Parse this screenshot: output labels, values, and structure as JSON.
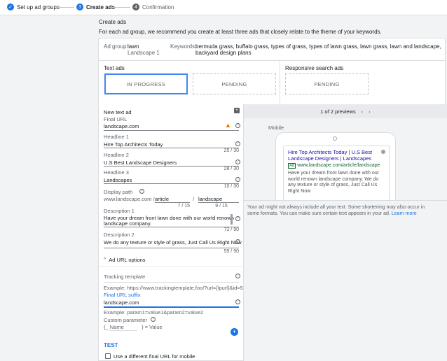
{
  "stepper": {
    "steps": [
      {
        "label": "Set up ad groups",
        "num": "✓"
      },
      {
        "label": "Create ads",
        "num": "3"
      },
      {
        "label": "Confirmation",
        "num": "4"
      }
    ]
  },
  "header": {
    "title": "Create ads",
    "description": "For each ad group, we recommend you create at least three ads that closely relate to the theme of your keywords."
  },
  "adgroup": {
    "label": "Ad group:",
    "name": "lawn",
    "sub": "Landscape 1",
    "keywords_label": "Keywords:",
    "keywords_line1": "bermuda grass, buffalo grass, types of grass, types of lawn grass, lawn grass, lawn and landscape,",
    "keywords_line2": "backyard design plans"
  },
  "adtypes": {
    "text_ads_title": "Text ads",
    "rsa_title": "Responsive search ads",
    "in_progress": "IN PROGRESS",
    "pending1": "PENDING",
    "pending2": "PENDING"
  },
  "form": {
    "title": "New text ad",
    "final_url_label": "Final URL",
    "final_url": "landscape.com",
    "h1_label": "Headline 1",
    "h1": "Hire Top Architects Today",
    "h1_count": "25 / 30",
    "h2_label": "Headline 2",
    "h2": "U.S Best Landscape Designers",
    "h2_count": "28 / 30",
    "h3_label": "Headline 3",
    "h3": "Landscapes",
    "h3_count": "10 / 30",
    "path_label": "Display path",
    "path_domain": "www.landscape.com /",
    "path1": "article",
    "path_sep": "/",
    "path2": "landscape",
    "path1_count": "7 / 15",
    "path2_count": "9 / 15",
    "d1_label": "Description 1",
    "d1_line1": "Have your dream front lawn done with our world renown",
    "d1_line2": "landscape company.",
    "d1_count": "72 / 90",
    "d2_label": "Description 2",
    "d2": "We do any texture or style of grass, Just Call Us Right Now",
    "d2_count": "59 / 90",
    "url_options": "Ad URL options",
    "tracking_label": "Tracking template",
    "tracking_example": "Example: https://www.trackingtemplate.foo/?url={lpurl}&id=5",
    "suffix_label": "Final URL suffix",
    "suffix_value": "landscape.com",
    "suffix_example": "Example: param1=value1&param2=value2",
    "custom_label": "Custom parameter",
    "custom_name": "{_ Name",
    "custom_eq": "} = Value",
    "test": "TEST",
    "mobile_checkbox": "Use a different final URL for mobile"
  },
  "preview": {
    "counter": "1 of 2 previews",
    "device": "Mobile",
    "ad_headline": "Hire Top Architects Today | U.S Best Landscape Designers | Landscapes",
    "ad_badge": "Ad",
    "ad_url": "www.landscape.com/article/landscape",
    "ad_desc": "Have your dream front lawn done with our world renown landscape company. We do any texture or style of grass, Just Call Us Right Now",
    "note": "Your ad might not always include all your text. Some shortening may also occur in some formats. You can make sure certain text appears in your ad.",
    "learn_more": "Learn more"
  }
}
